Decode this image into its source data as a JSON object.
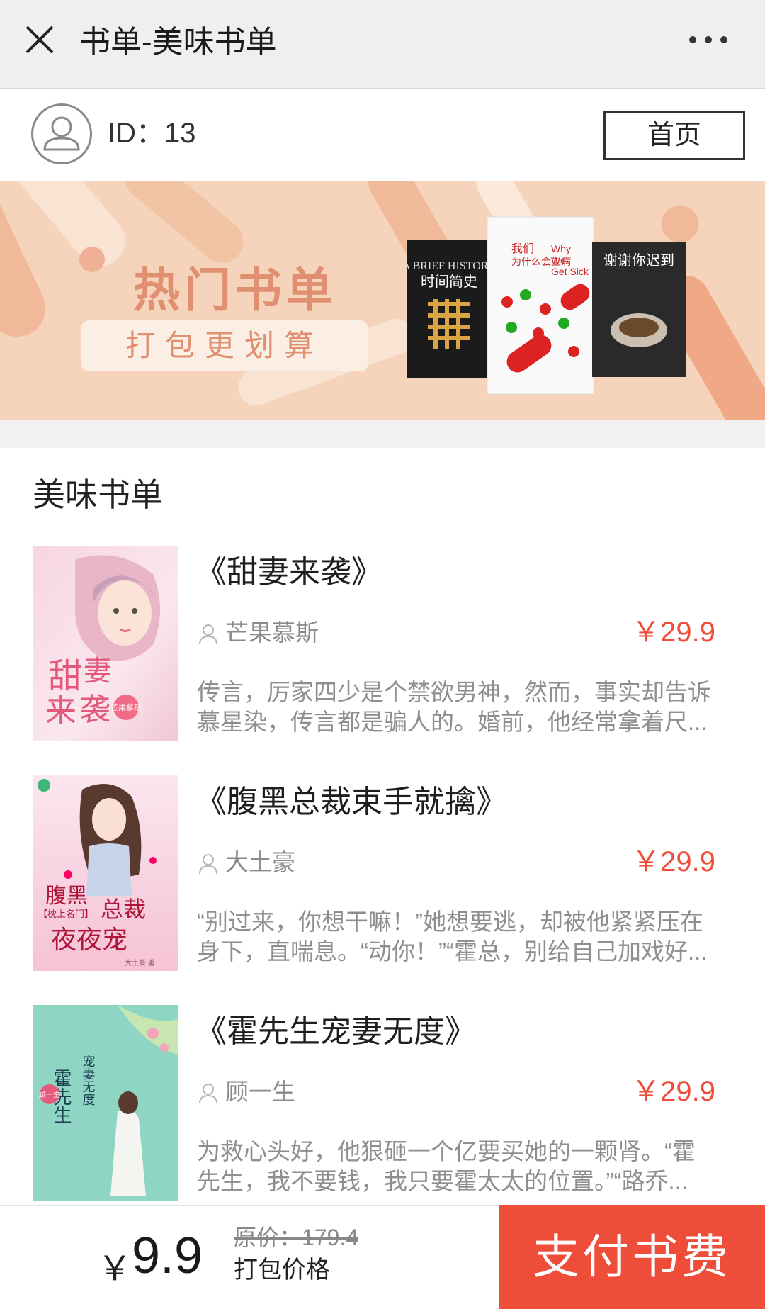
{
  "topbar": {
    "title": "书单-美味书单"
  },
  "user": {
    "id_label": "ID：13",
    "home_button": "首页"
  },
  "banner": {
    "title": "热门书单",
    "subtitle": "打包更划算",
    "covers": [
      {
        "title": "时间简史",
        "subtitle": "A BRIEF HISTORY OF TIME"
      },
      {
        "title": "我们为什么会生病",
        "subtitle": "Why We Get Sick"
      },
      {
        "title": "谢谢你迟到"
      }
    ]
  },
  "section": {
    "title": "美味书单"
  },
  "books": [
    {
      "title": "《甜妻来袭》",
      "author": "芒果慕斯",
      "price": "￥29.9",
      "desc": "传言，厉家四少是个禁欲男神，然而，事实却告诉慕星染，传言都是骗人的。婚前，他经常拿着尺...",
      "cover_text": "甜妻来袭",
      "cover_badge": "芒果慕斯"
    },
    {
      "title": "《腹黑总裁束手就擒》",
      "author": "大土豪",
      "price": "￥29.9",
      "desc": "“别过来，你想干嘛！”她想要逃，却被他紧紧压在身下，直喘息。“动你！”“霍总，别给自己加戏好...",
      "cover_text": "腹黑总裁夜夜宠",
      "cover_badge": "【枕上名门】"
    },
    {
      "title": "《霍先生宠妻无度》",
      "author": "顾一生",
      "price": "￥29.9",
      "desc": "为救心头好，他狠砸一个亿要买她的一颗肾。“霍先生，我不要钱，我只要霍太太的位置。”“路乔...",
      "cover_text": "霍先生宠妻无度",
      "cover_badge": "顾一生"
    }
  ],
  "bottom": {
    "yen": "￥",
    "pack_price": "9.9",
    "original_price": "原价：179.4",
    "pack_label": "打包价格",
    "pay_button": "支付书费"
  },
  "colors": {
    "accent": "#ee4d3a",
    "banner_bg": "#f6d3bb",
    "banner_text": "#e09070"
  }
}
